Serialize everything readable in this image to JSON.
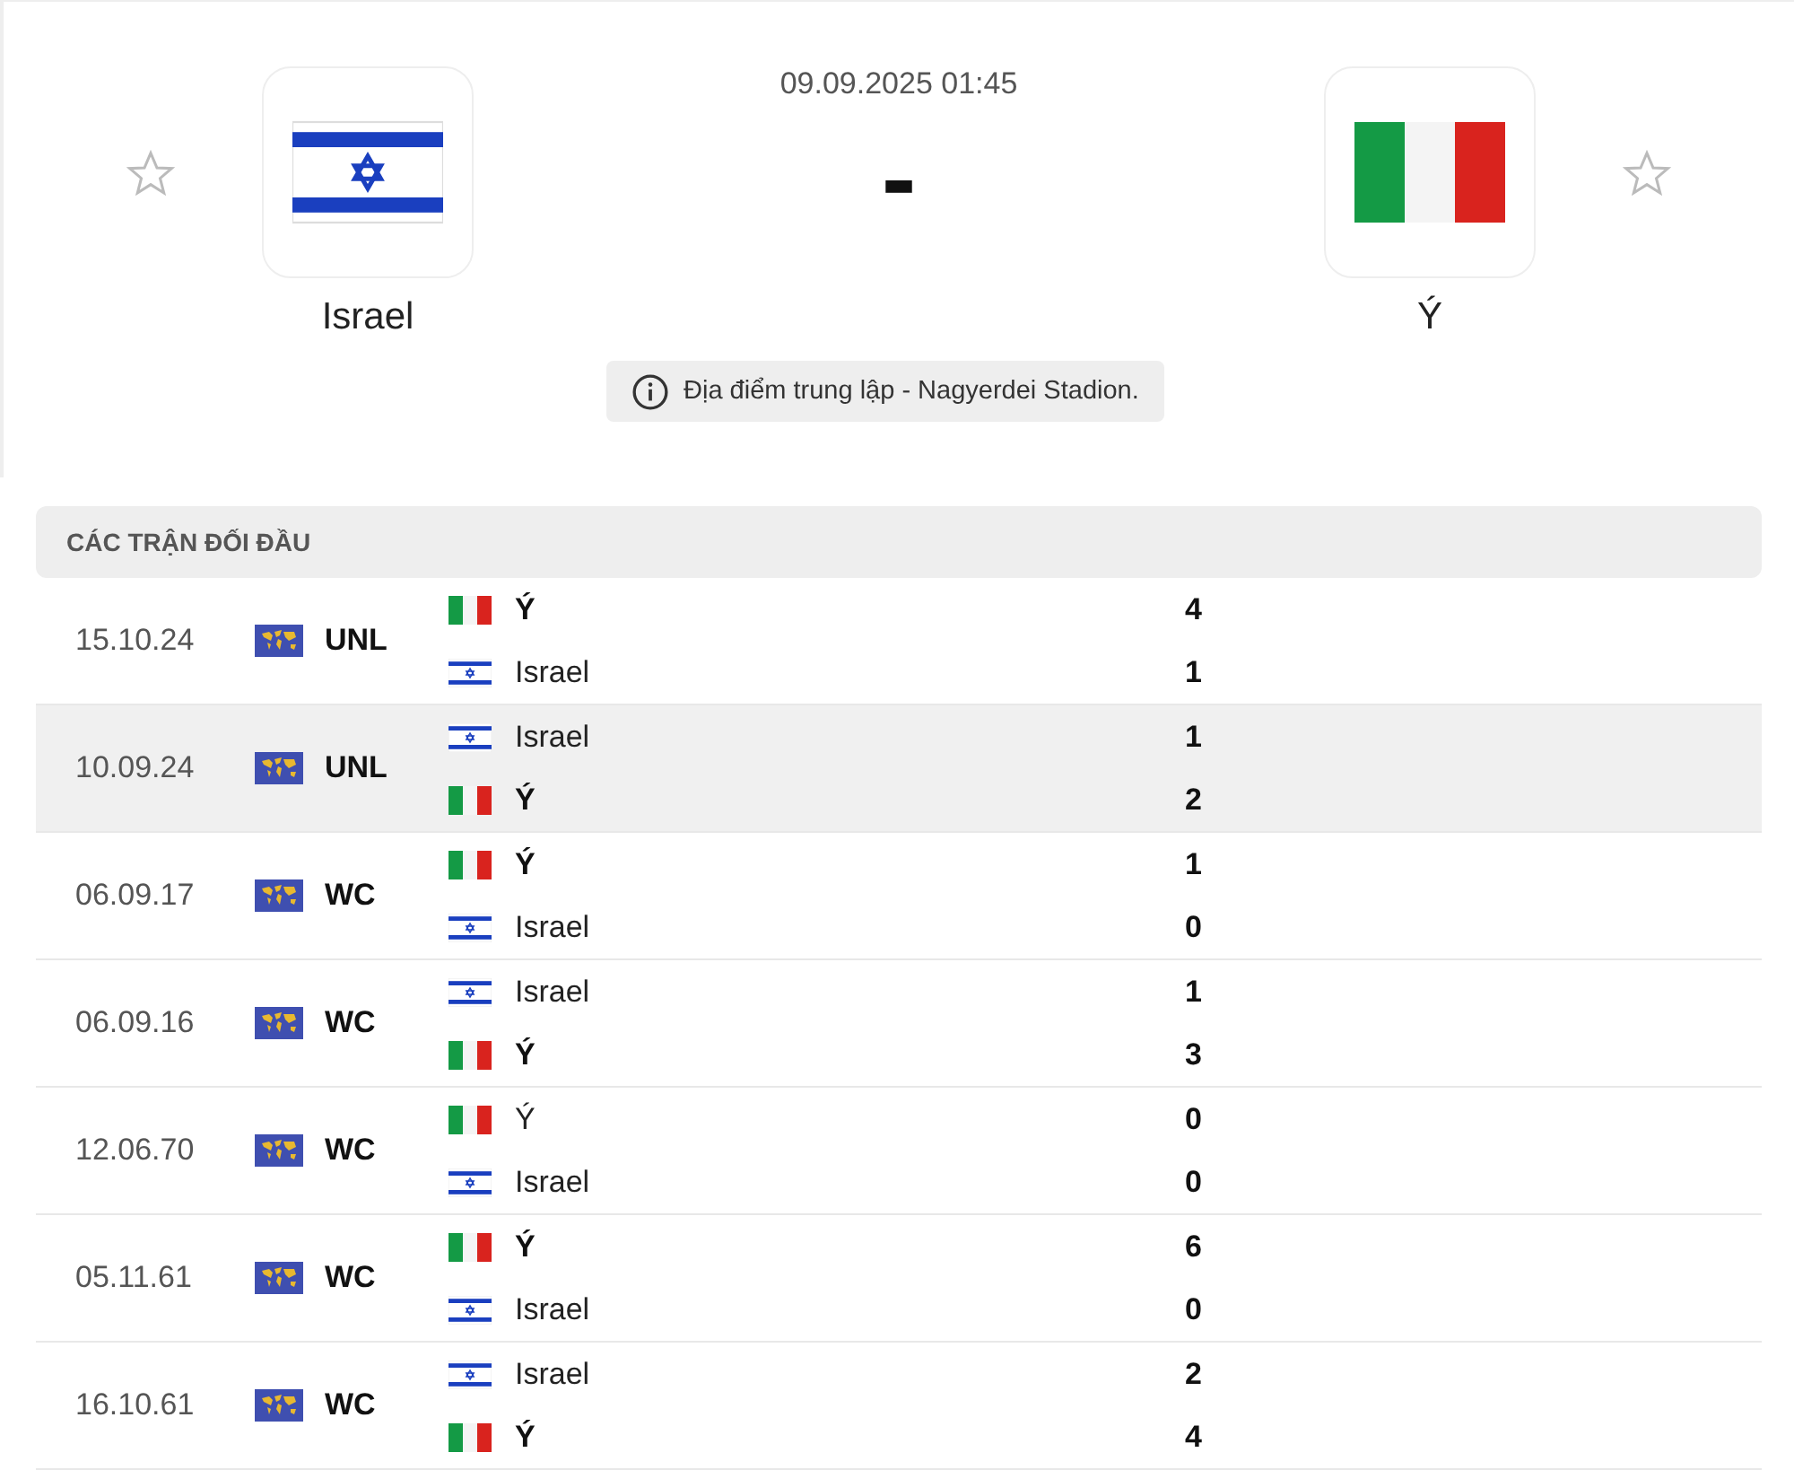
{
  "match": {
    "datetime": "09.09.2025 01:45",
    "score": "-",
    "home": {
      "name": "Israel",
      "kind": "israel",
      "favorite": false
    },
    "away": {
      "name": "Ý",
      "kind": "italy",
      "favorite": false
    },
    "venue": "Địa điểm trung lập - Nagyerdei Stadion."
  },
  "h2h": {
    "title": "CÁC TRẬN ĐỐI ĐẦU",
    "matches": [
      {
        "date": "15.10.24",
        "competition": "UNL",
        "highlighted": false,
        "teams": [
          {
            "name": "Ý",
            "kind": "italy",
            "winner": true,
            "score": "4"
          },
          {
            "name": "Israel",
            "kind": "israel",
            "winner": false,
            "score": "1"
          }
        ]
      },
      {
        "date": "10.09.24",
        "competition": "UNL",
        "highlighted": true,
        "teams": [
          {
            "name": "Israel",
            "kind": "israel",
            "winner": false,
            "score": "1"
          },
          {
            "name": "Ý",
            "kind": "italy",
            "winner": true,
            "score": "2"
          }
        ]
      },
      {
        "date": "06.09.17",
        "competition": "WC",
        "highlighted": false,
        "teams": [
          {
            "name": "Ý",
            "kind": "italy",
            "winner": true,
            "score": "1"
          },
          {
            "name": "Israel",
            "kind": "israel",
            "winner": false,
            "score": "0"
          }
        ]
      },
      {
        "date": "06.09.16",
        "competition": "WC",
        "highlighted": false,
        "teams": [
          {
            "name": "Israel",
            "kind": "israel",
            "winner": false,
            "score": "1"
          },
          {
            "name": "Ý",
            "kind": "italy",
            "winner": true,
            "score": "3"
          }
        ]
      },
      {
        "date": "12.06.70",
        "competition": "WC",
        "highlighted": false,
        "teams": [
          {
            "name": "Ý",
            "kind": "italy",
            "winner": false,
            "score": "0"
          },
          {
            "name": "Israel",
            "kind": "israel",
            "winner": false,
            "score": "0"
          }
        ]
      },
      {
        "date": "05.11.61",
        "competition": "WC",
        "highlighted": false,
        "teams": [
          {
            "name": "Ý",
            "kind": "italy",
            "winner": true,
            "score": "6"
          },
          {
            "name": "Israel",
            "kind": "israel",
            "winner": false,
            "score": "0"
          }
        ]
      },
      {
        "date": "16.10.61",
        "competition": "WC",
        "highlighted": false,
        "teams": [
          {
            "name": "Israel",
            "kind": "israel",
            "winner": false,
            "score": "2"
          },
          {
            "name": "Ý",
            "kind": "italy",
            "winner": true,
            "score": "4"
          }
        ]
      }
    ]
  }
}
